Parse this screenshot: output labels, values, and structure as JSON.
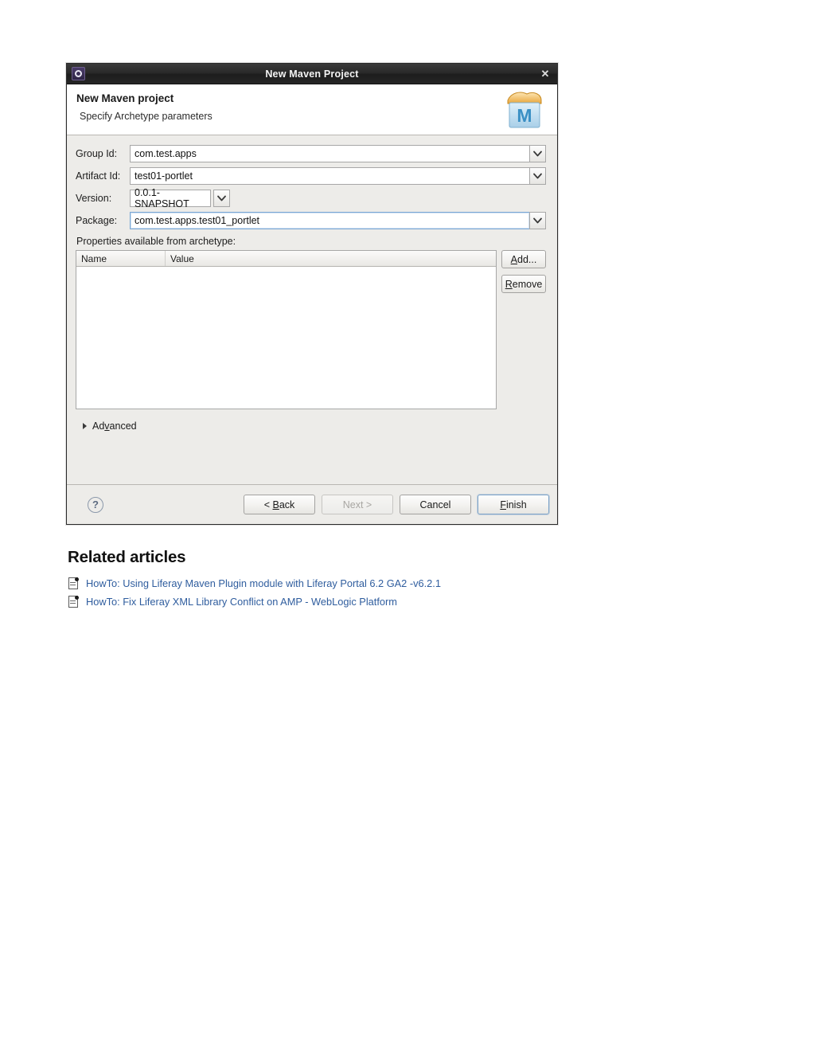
{
  "dialog": {
    "window_title": "New Maven Project",
    "app_icon": "maven-ring-icon",
    "close_label": "✕",
    "header": {
      "title": "New Maven project",
      "subtitle": "Specify Archetype parameters",
      "logo_letter": "M",
      "logo_name": "maven-logo-icon"
    },
    "fields": [
      {
        "label": "Group Id:",
        "value": "com.test.apps",
        "type": "combo-wide",
        "focused": false
      },
      {
        "label": "Artifact Id:",
        "value": "test01-portlet",
        "type": "combo-wide",
        "focused": false
      },
      {
        "label": "Version:",
        "value": "0.0.1-SNAPSHOT",
        "type": "combo-narrow",
        "focused": false
      },
      {
        "label": "Package:",
        "value": "com.test.apps.test01_portlet",
        "type": "combo-wide",
        "focused": true
      }
    ],
    "properties": {
      "section_label": "Properties available from archetype:",
      "columns": [
        "Name",
        "Value"
      ],
      "rows": [],
      "add_button": "Add...",
      "remove_button": "Remove"
    },
    "advanced": {
      "label": "Advanced",
      "expanded": false
    },
    "footer": {
      "help_glyph": "?",
      "buttons": [
        {
          "label": "< Back",
          "state": "enabled"
        },
        {
          "label": "Next >",
          "state": "disabled"
        },
        {
          "label": "Cancel",
          "state": "enabled"
        },
        {
          "label": "Finish",
          "state": "default"
        }
      ]
    }
  },
  "related": {
    "heading": "Related articles",
    "articles": [
      "HowTo: Using Liferay Maven Plugin module with Liferay Portal 6.2 GA2 -v6.2.1",
      "HowTo: Fix Liferay XML Library Conflict on AMP - WebLogic Platform"
    ]
  },
  "colors": {
    "titlebar": "#262626",
    "dialog_bg": "#edece9",
    "link": "#2f5d9e",
    "focus_border": "#7aa7d4"
  }
}
